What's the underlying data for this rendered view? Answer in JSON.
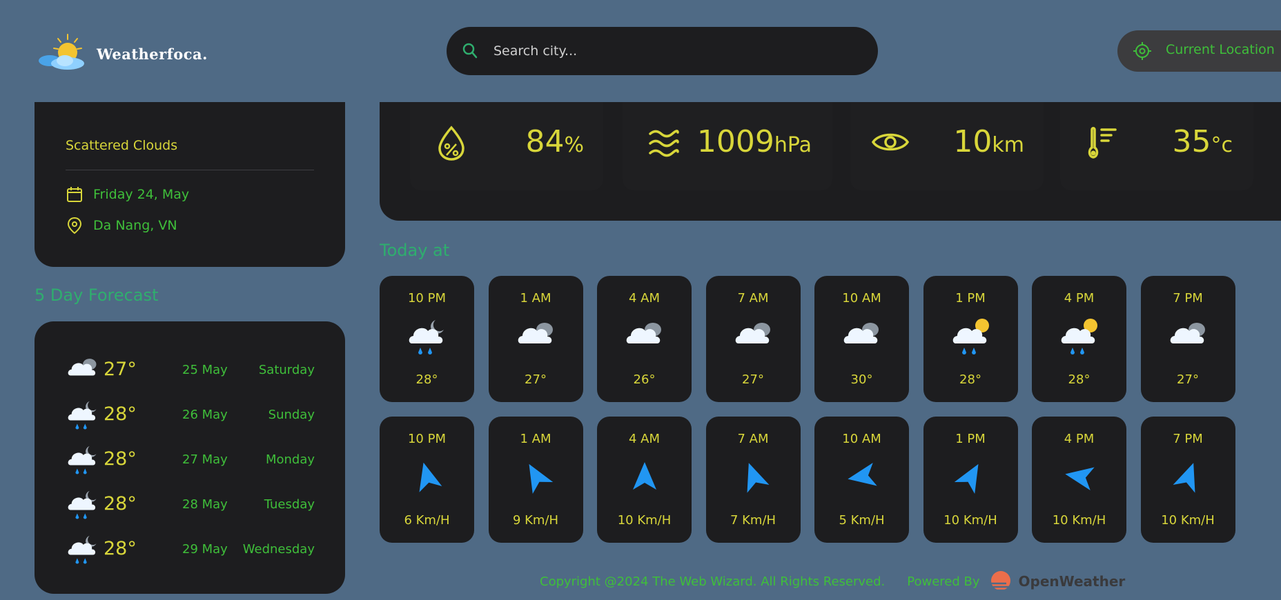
{
  "header": {
    "logo_text": "Weatherfoca.",
    "search_placeholder": "Search city...",
    "current_location_label": "Current Location"
  },
  "current": {
    "condition": "Scattered Clouds",
    "date": "Friday 24, May",
    "location": "Da Nang, VN"
  },
  "forecast": {
    "title": "5 Day Forecast",
    "items": [
      {
        "icon": "cloudy-icon",
        "temp": "27°",
        "date": "25 May",
        "day": "Saturday"
      },
      {
        "icon": "night-rain-icon",
        "temp": "28°",
        "date": "26 May",
        "day": "Sunday"
      },
      {
        "icon": "night-rain-icon",
        "temp": "28°",
        "date": "27 May",
        "day": "Monday"
      },
      {
        "icon": "night-rain-icon",
        "temp": "28°",
        "date": "28 May",
        "day": "Tuesday"
      },
      {
        "icon": "night-rain-icon",
        "temp": "28°",
        "date": "29 May",
        "day": "Wednesday"
      }
    ]
  },
  "highlights": {
    "humidity": {
      "value": "84",
      "unit": "%",
      "icon": "humidity-icon"
    },
    "pressure": {
      "value": "1009",
      "unit": "hPa",
      "icon": "pressure-waves-icon"
    },
    "visibility": {
      "value": "10",
      "unit": "km",
      "icon": "eye-icon"
    },
    "feels_like": {
      "value": "35",
      "unit": "°c",
      "icon": "thermometer-icon"
    }
  },
  "today": {
    "title": "Today at",
    "temps": [
      {
        "time": "10 PM",
        "icon": "night-rain-icon",
        "temp": "28°"
      },
      {
        "time": "1 AM",
        "icon": "cloudy-icon",
        "temp": "27°"
      },
      {
        "time": "4 AM",
        "icon": "cloudy-icon",
        "temp": "26°"
      },
      {
        "time": "7 AM",
        "icon": "cloudy-icon",
        "temp": "27°"
      },
      {
        "time": "10 AM",
        "icon": "cloudy-icon",
        "temp": "30°"
      },
      {
        "time": "1 PM",
        "icon": "day-rain-icon",
        "temp": "28°"
      },
      {
        "time": "4 PM",
        "icon": "day-rain-icon",
        "temp": "28°"
      },
      {
        "time": "7 PM",
        "icon": "cloudy-icon",
        "temp": "27°"
      }
    ],
    "wind": [
      {
        "time": "10 PM",
        "deg": -15,
        "speed": "6 Km/H"
      },
      {
        "time": "1 AM",
        "deg": -30,
        "speed": "9 Km/H"
      },
      {
        "time": "4 AM",
        "deg": 0,
        "speed": "10 Km/H"
      },
      {
        "time": "7 AM",
        "deg": -20,
        "speed": "7 Km/H"
      },
      {
        "time": "10 AM",
        "deg": -100,
        "speed": "5 Km/H"
      },
      {
        "time": "1 PM",
        "deg": 30,
        "speed": "10 Km/H"
      },
      {
        "time": "4 PM",
        "deg": -80,
        "speed": "10 Km/H"
      },
      {
        "time": "7 PM",
        "deg": 20,
        "speed": "10 Km/H"
      }
    ]
  },
  "footer": {
    "copyright": "Copyright @2024 The Web Wizard. All Rights Reserved.",
    "powered_by": "Powered By",
    "provider": "OpenWeather"
  },
  "colors": {
    "background": "#4f6a85",
    "card": "#1d1d1f",
    "accent_yellow": "#d8d63a",
    "accent_green": "#3fbf3a",
    "wind_arrow": "#2196f3"
  }
}
